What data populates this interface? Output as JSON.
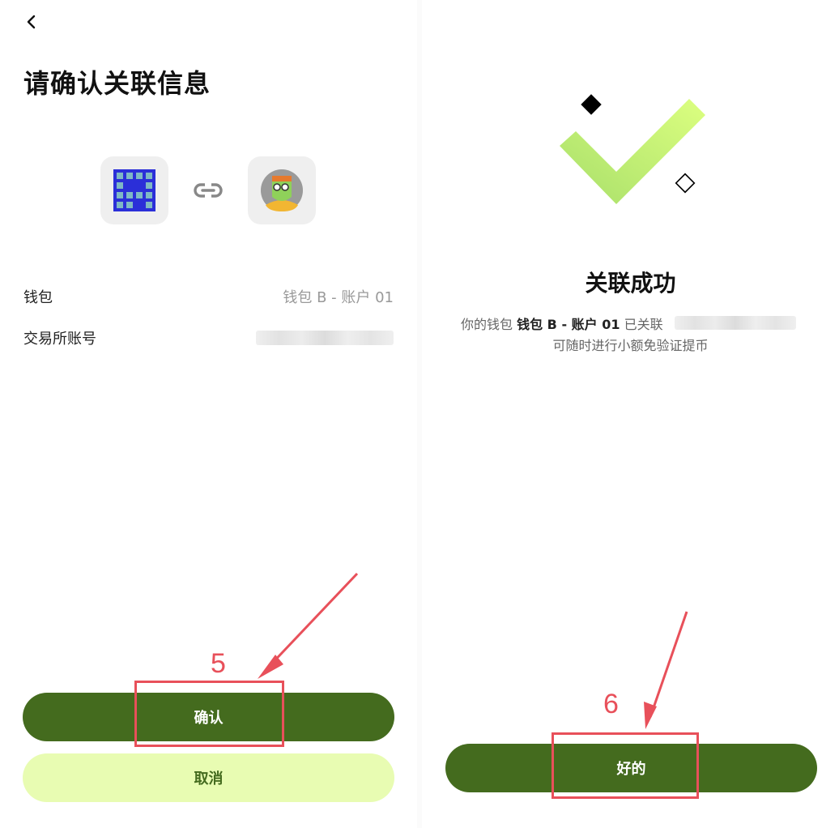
{
  "confirm_screen": {
    "title": "请确认关联信息",
    "wallet_label": "钱包",
    "wallet_value": "钱包 B - 账户 01",
    "exchange_account_label": "交易所账号",
    "confirm_button": "确认",
    "cancel_button": "取消",
    "annotation_step": "5"
  },
  "success_screen": {
    "title": "关联成功",
    "message_prefix": "你的钱包",
    "message_wallet": "钱包 B - 账户 01",
    "message_suffix": "已关联",
    "message_line2": "可随时进行小额免验证提币",
    "ok_button": "好的",
    "annotation_step": "6"
  },
  "colors": {
    "primary_green": "#446b1e",
    "light_green": "#e8fcb2",
    "check_gradient": [
      "#a8df6a",
      "#dcff80"
    ],
    "annotation_red": "#e8505a"
  },
  "icons": {
    "back": "chevron-left-icon",
    "wallet": "wallet-logo-icon",
    "link": "link-icon",
    "exchange": "nft-avatar-icon",
    "success": "checkmark-icon"
  }
}
